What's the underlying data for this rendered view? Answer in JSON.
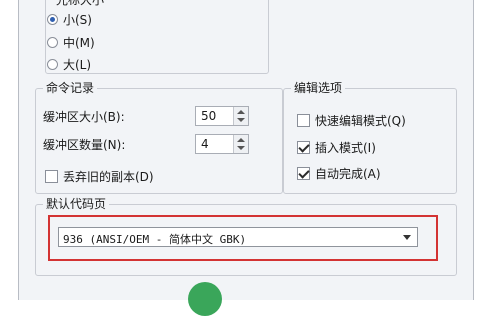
{
  "cursor_size": {
    "title": "光标大小",
    "options": [
      {
        "label": "小(S)",
        "checked": true
      },
      {
        "label": "中(M)",
        "checked": false
      },
      {
        "label": "大(L)",
        "checked": false
      }
    ]
  },
  "command_history": {
    "title": "命令记录",
    "buffer_size_label": "缓冲区大小(B):",
    "buffer_size_value": "50",
    "buffer_count_label": "缓冲区数量(N):",
    "buffer_count_value": "4",
    "discard_old": {
      "label": "丢弃旧的副本(D)",
      "checked": false
    }
  },
  "edit_options": {
    "title": "编辑选项",
    "items": [
      {
        "label": "快速编辑模式(Q)",
        "checked": false
      },
      {
        "label": "插入模式(I)",
        "checked": true
      },
      {
        "label": "自动完成(A)",
        "checked": true
      }
    ]
  },
  "code_page": {
    "title": "默认代码页",
    "selected": "936  (ANSI/OEM - 简体中文 GBK)"
  },
  "colors": {
    "highlight": "#d33333"
  }
}
